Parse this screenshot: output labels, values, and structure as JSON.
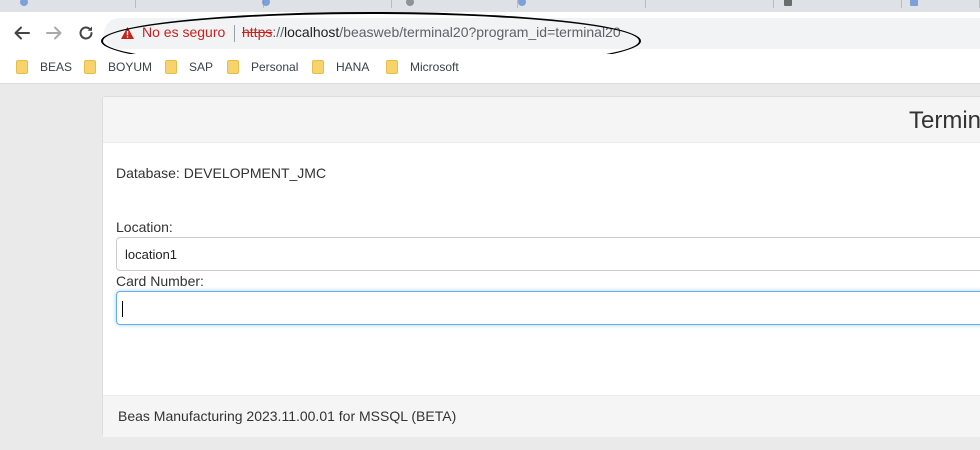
{
  "browser": {
    "security_label": "No es seguro",
    "url_scheme": "https",
    "url_sep": "://",
    "url_host": "localhost",
    "url_path": "/beasweb/terminal20?program_id=terminal20",
    "bookmarks": [
      "BEAS",
      "BOYUM",
      "SAP",
      "Personal",
      "HANA",
      "Microsoft"
    ]
  },
  "page": {
    "title": "Termin",
    "database_label": "Database: DEVELOPMENT_JMC",
    "location_label": "Location:",
    "location_value": "location1",
    "card_number_label": "Card Number:",
    "card_number_value": "",
    "footer": "Beas Manufacturing 2023.11.00.01 for MSSQL (BETA)"
  },
  "colors": {
    "insecure": "#c5221f",
    "focus_border": "#66afe9",
    "folder": "#f8d36b"
  }
}
